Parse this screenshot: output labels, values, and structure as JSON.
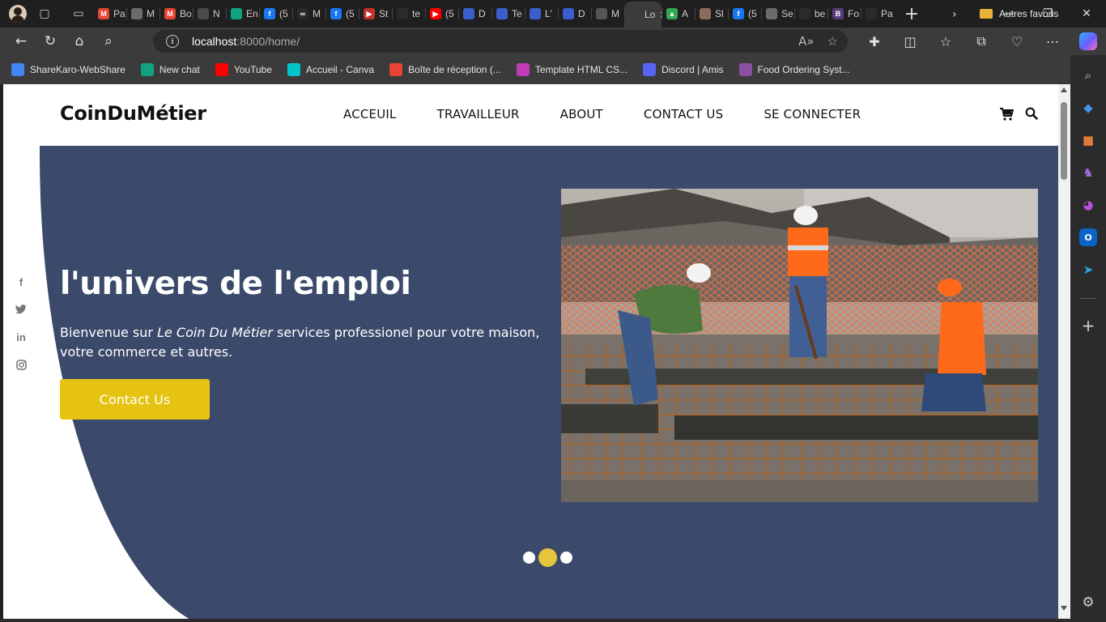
{
  "browser": {
    "tabs": [
      {
        "label": "Pa",
        "icon": "gmail-icon",
        "color": "#ea4335",
        "glyph": "M"
      },
      {
        "label": "M",
        "icon": "document-icon",
        "color": "#6b6b6b",
        "glyph": ""
      },
      {
        "label": "Bo",
        "icon": "gmail-icon",
        "color": "#ea4335",
        "glyph": "M"
      },
      {
        "label": "N",
        "icon": "app-icon",
        "color": "#4a4a4a",
        "glyph": ""
      },
      {
        "label": "En",
        "icon": "chatgpt-icon",
        "color": "#10a37f",
        "glyph": ""
      },
      {
        "label": "(5",
        "icon": "facebook-icon",
        "color": "#1877f2",
        "glyph": "f"
      },
      {
        "label": "M",
        "icon": "meta-icon",
        "color": "#2a2a2a",
        "glyph": "∞"
      },
      {
        "label": "(5",
        "icon": "facebook-icon",
        "color": "#1877f2",
        "glyph": "f"
      },
      {
        "label": "St",
        "icon": "video-icon",
        "color": "#c4302b",
        "glyph": "▶"
      },
      {
        "label": "te",
        "icon": "globe-icon",
        "color": "#2a2a2a",
        "glyph": ""
      },
      {
        "label": "(5",
        "icon": "youtube-icon",
        "color": "#ff0000",
        "glyph": "▶"
      },
      {
        "label": "D",
        "icon": "globe-icon",
        "color": "#3a5fcd",
        "glyph": ""
      },
      {
        "label": "Te",
        "icon": "globe-icon",
        "color": "#3a5fcd",
        "glyph": ""
      },
      {
        "label": "L'",
        "icon": "globe-icon",
        "color": "#3a5fcd",
        "glyph": ""
      },
      {
        "label": "D",
        "icon": "globe-icon",
        "color": "#3a5fcd",
        "glyph": ""
      },
      {
        "label": "M",
        "icon": "apple-icon",
        "color": "#555555",
        "glyph": ""
      },
      {
        "label": "Lo",
        "icon": "globe-icon",
        "color": "#3b3b3b",
        "glyph": "",
        "active": true
      },
      {
        "label": "A",
        "icon": "drive-icon",
        "color": "#34a853",
        "glyph": "▲"
      },
      {
        "label": "Sl",
        "icon": "app-icon",
        "color": "#8a6d5a",
        "glyph": ""
      },
      {
        "label": "(5",
        "icon": "facebook-icon",
        "color": "#1877f2",
        "glyph": "f"
      },
      {
        "label": "Se",
        "icon": "document-icon",
        "color": "#6b6b6b",
        "glyph": ""
      },
      {
        "label": "be",
        "icon": "search-icon",
        "color": "#2a2a2a",
        "glyph": ""
      },
      {
        "label": "Fo",
        "icon": "bootstrap-icon",
        "color": "#563d7c",
        "glyph": "B"
      },
      {
        "label": "Pa",
        "icon": "globe-icon",
        "color": "#2a2a2a",
        "glyph": ""
      }
    ],
    "url_host": "localhost",
    "url_rest": ":8000/home/",
    "bookmarks": [
      {
        "label": "ShareKaro-WebShare",
        "icon": "sharekaro-icon",
        "color": "#4285f4"
      },
      {
        "label": "New chat",
        "icon": "chatgpt-icon",
        "color": "#10a37f"
      },
      {
        "label": "YouTube",
        "icon": "youtube-icon",
        "color": "#ff0000"
      },
      {
        "label": "Accueil - Canva",
        "icon": "canva-icon",
        "color": "#00c4cc"
      },
      {
        "label": "Boîte de réception (...",
        "icon": "gmail-icon",
        "color": "#ea4335"
      },
      {
        "label": "Template HTML CS...",
        "icon": "template-icon",
        "color": "#c03bb5"
      },
      {
        "label": "Discord | Amis",
        "icon": "discord-icon",
        "color": "#5865f2"
      },
      {
        "label": "Food Ordering Syst...",
        "icon": "food-icon",
        "color": "#8a4fa0"
      }
    ],
    "other_bookmarks": "Autres favoris"
  },
  "site": {
    "logo": "CoinDuMétier",
    "menu": [
      "ACCEUIL",
      "TRAVAILLEUR",
      "ABOUT",
      "CONTACT US",
      "SE CONNECTER"
    ],
    "hero": {
      "title": "l'univers de l'emploi",
      "text_before": "Bienvenue sur ",
      "text_italic": "Le Coin Du Métier",
      "text_after": " services professionel pour votre maison, votre commerce et autres.",
      "button": "Contact Us"
    },
    "carousel": {
      "count": 3,
      "active_index": 1
    },
    "colors": {
      "hero_bg": "#3b4a6b",
      "accent": "#e6c212",
      "dot_active": "#e6c53d"
    },
    "social": [
      "facebook-icon",
      "twitter-icon",
      "linkedin-icon",
      "instagram-icon"
    ]
  }
}
